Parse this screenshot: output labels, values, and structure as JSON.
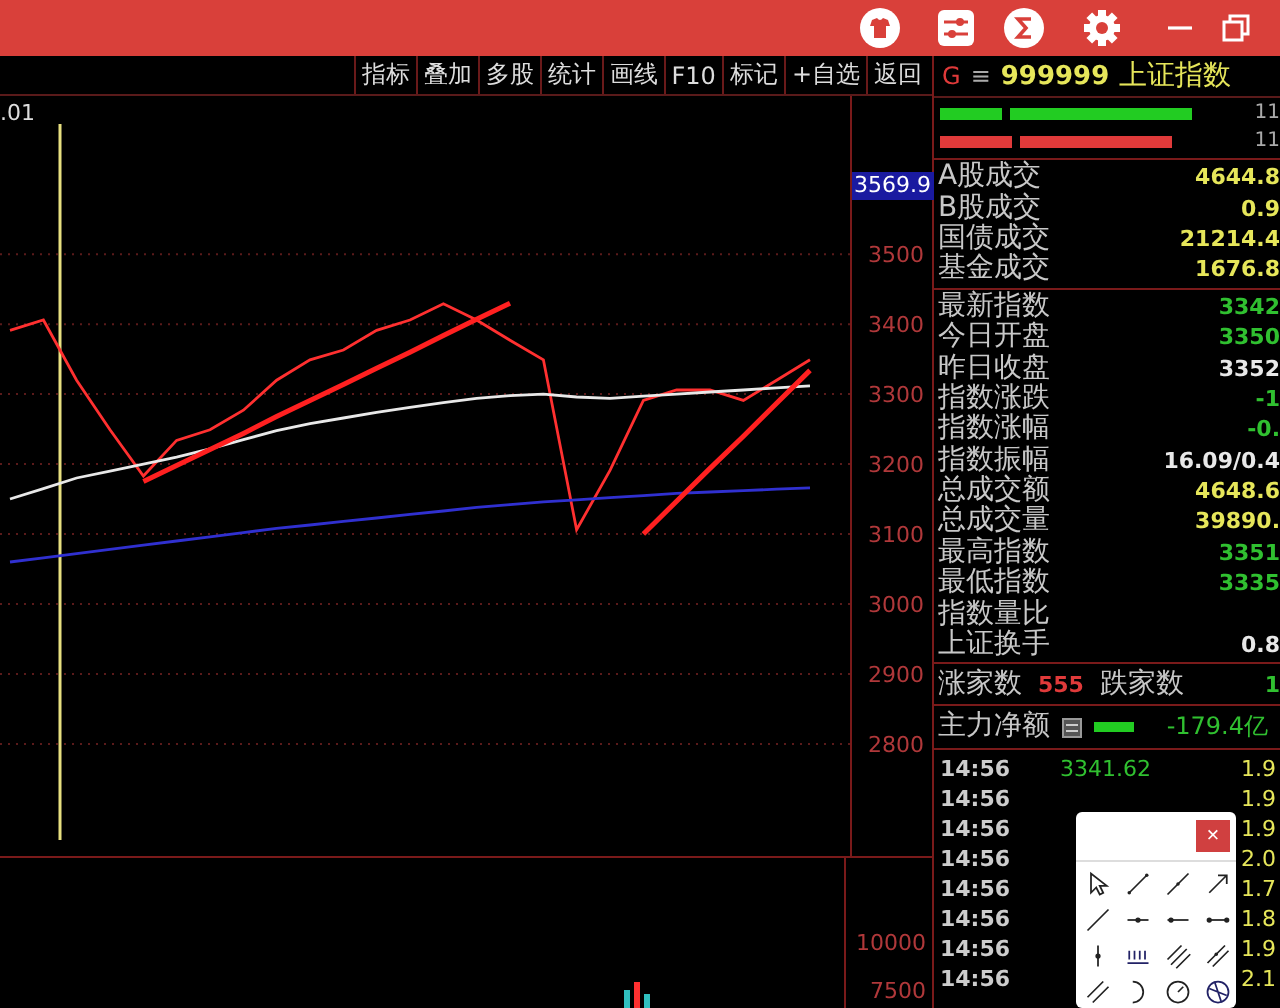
{
  "toolbar": {
    "buttons": [
      "指标",
      "叠加",
      "多股",
      "统计",
      "画线",
      "F10",
      "标记",
      "+自选",
      "返回"
    ]
  },
  "chart": {
    "corner_label": ".01",
    "current_price": "3569.9",
    "chart_data": {
      "type": "line",
      "ylim": [
        2640,
        3726
      ],
      "grid": true,
      "yticks": [
        2800,
        2900,
        3000,
        3100,
        3200,
        3300,
        3400,
        3500
      ],
      "series": [
        {
          "color": "#ff3030",
          "values": [
            3391,
            3406,
            3320,
            3249,
            3183,
            3234,
            3249,
            3277,
            3320,
            3349,
            3363,
            3391,
            3406,
            3429,
            3406,
            3377,
            3349,
            3106,
            3191,
            3291,
            3306,
            3306,
            3291,
            3320,
            3349
          ]
        },
        {
          "color": "#e8e8e8",
          "values": [
            3150,
            3165,
            3180,
            3190,
            3200,
            3210,
            3222,
            3235,
            3248,
            3258,
            3266,
            3274,
            3281,
            3288,
            3294,
            3298,
            3300,
            3296,
            3294,
            3297,
            3300,
            3303,
            3306,
            3309,
            3312
          ]
        },
        {
          "color": "#3030d0",
          "values": [
            3060,
            3066,
            3072,
            3078,
            3084,
            3090,
            3096,
            3102,
            3108,
            3113,
            3118,
            3123,
            3128,
            3133,
            3138,
            3142,
            3146,
            3149,
            3152,
            3155,
            3158,
            3160,
            3162,
            3164,
            3166
          ]
        },
        {
          "color": "#ff2020",
          "values": [
            null,
            null,
            null,
            null,
            3175,
            3198,
            3221,
            3244,
            3268,
            3291,
            3314,
            3337,
            3360,
            3384,
            3407,
            3430,
            null,
            null,
            null,
            null,
            null,
            null,
            null,
            null,
            null
          ]
        },
        {
          "color": "#ff2020",
          "values": [
            null,
            null,
            null,
            null,
            null,
            null,
            null,
            null,
            null,
            null,
            null,
            null,
            null,
            null,
            null,
            null,
            null,
            null,
            null,
            3100,
            3147,
            3194,
            3240,
            3287,
            3334
          ]
        }
      ]
    }
  },
  "volume_panel": {
    "axis_labels": [
      "10000",
      "7500"
    ]
  },
  "quote": {
    "market_flag": "G",
    "menu_glyph": "≡",
    "code": "999999",
    "name": "上证指数",
    "ratio_bars": [
      {
        "color": "#22cc22",
        "segments": [
          {
            "level": 0.18
          },
          {
            "level": 0.74
          }
        ],
        "value": "11"
      },
      {
        "color": "#e03a3a",
        "segments": [
          {
            "level": 0.21
          },
          {
            "level": 0.68
          }
        ],
        "value": "11"
      }
    ],
    "turnover": [
      {
        "label": "A股成交",
        "value": "4644.8",
        "color": "#e6e65a"
      },
      {
        "label": "B股成交",
        "value": "0.9",
        "color": "#e6e65a"
      },
      {
        "label": "国债成交",
        "value": "21214.4",
        "color": "#e6e65a"
      },
      {
        "label": "基金成交",
        "value": "1676.8",
        "color": "#e6e65a"
      }
    ],
    "stats": [
      {
        "label": "最新指数",
        "value": "3342",
        "color": "#30c030"
      },
      {
        "label": "今日开盘",
        "value": "3350",
        "color": "#30c030"
      },
      {
        "label": "昨日收盘",
        "value": "3352",
        "color": "#e8e8e8"
      },
      {
        "label": "指数涨跌",
        "value": "-1",
        "color": "#30c030"
      },
      {
        "label": "指数涨幅",
        "value": "-0.",
        "color": "#30c030"
      },
      {
        "label": "指数振幅",
        "value": "16.09/0.4",
        "color": "#e8e8e8"
      },
      {
        "label": "总成交额",
        "value": "4648.6",
        "color": "#e6e65a"
      },
      {
        "label": "总成交量",
        "value": "39890.",
        "color": "#e6e65a"
      },
      {
        "label": "最高指数",
        "value": "3351",
        "color": "#30c030"
      },
      {
        "label": "最低指数",
        "value": "3335",
        "color": "#30c030"
      },
      {
        "label": "指数量比"
      },
      {
        "label": "上证换手",
        "value": "0.8",
        "color": "#e8e8e8"
      }
    ],
    "breadth": {
      "up_label": "涨家数",
      "up_count": "555",
      "down_label": "跌家数",
      "down_count": "1"
    },
    "net_flow": {
      "label": "主力净额",
      "value": "-179.4亿"
    },
    "ticks": [
      {
        "time": "14:56",
        "price": "3341.62",
        "volume": "1.9"
      },
      {
        "time": "14:56",
        "volume": "1.9"
      },
      {
        "time": "14:56",
        "volume": "1.9"
      },
      {
        "time": "14:56",
        "volume": "2.0"
      },
      {
        "time": "14:56",
        "volume": "1.7"
      },
      {
        "time": "14:56",
        "volume": "1.8"
      },
      {
        "time": "14:56",
        "volume": "1.9"
      },
      {
        "time": "14:56",
        "volume": "2.1"
      }
    ]
  },
  "drawing_tools": {
    "close": "×"
  }
}
